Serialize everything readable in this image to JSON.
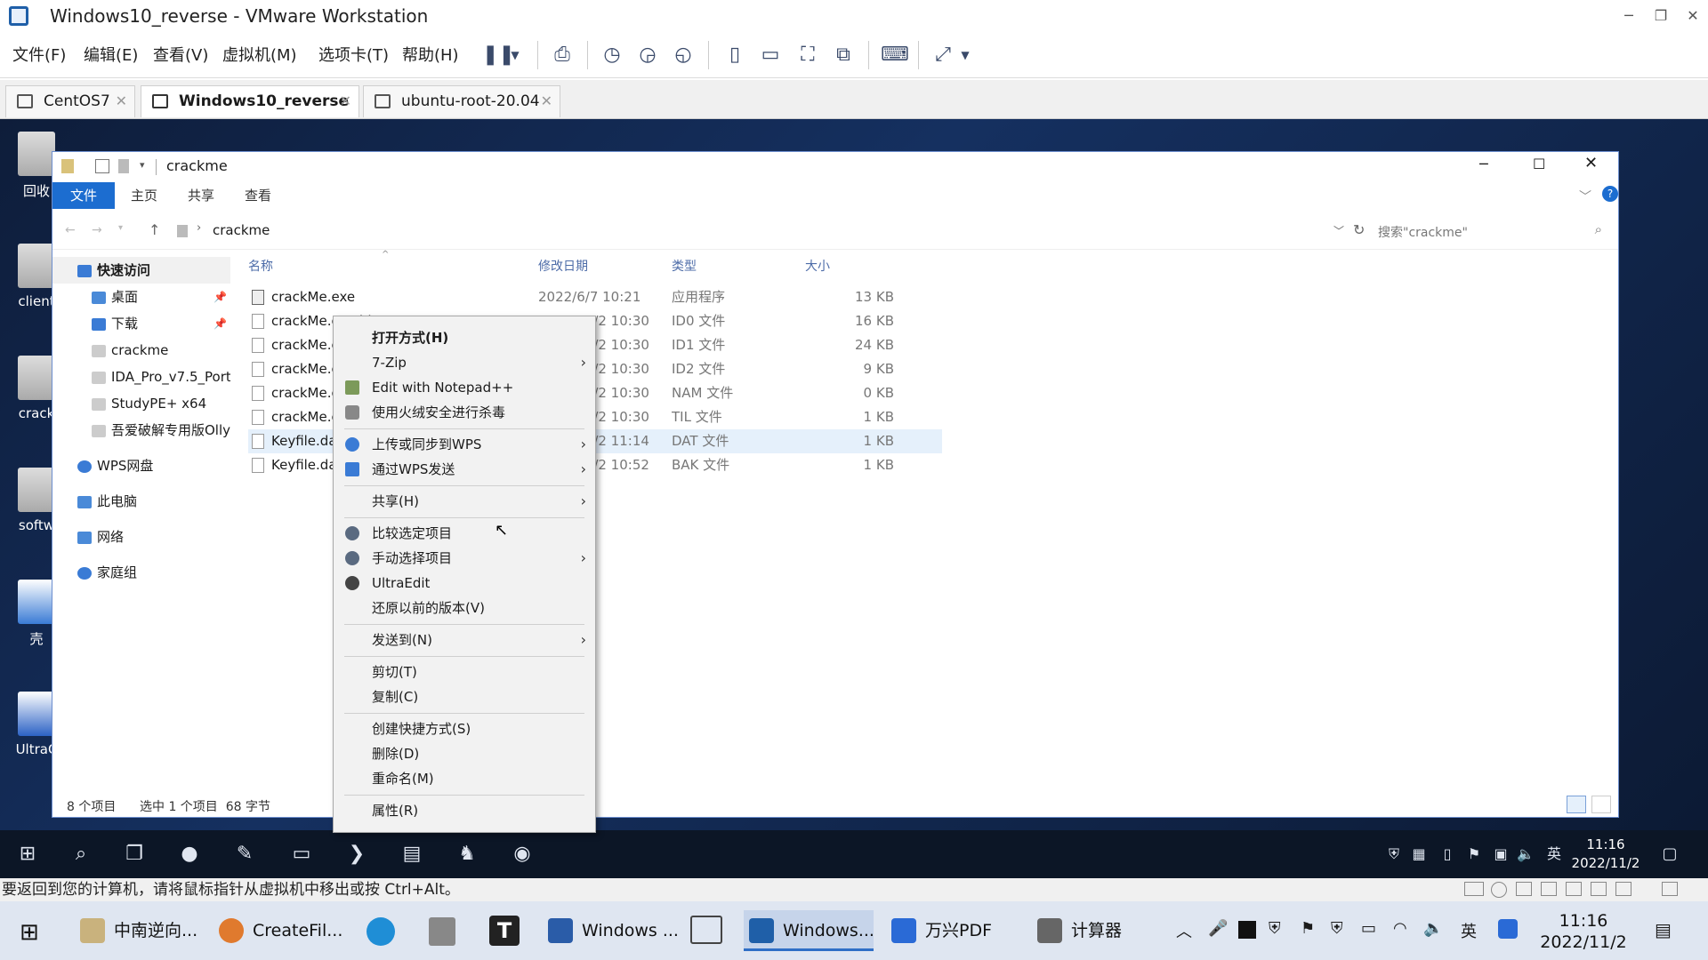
{
  "vmware": {
    "title": "Windows10_reverse - VMware Workstation",
    "menu": [
      "文件(F)",
      "编辑(E)",
      "查看(V)",
      "虚拟机(M)",
      "选项卡(T)",
      "帮助(H)"
    ],
    "tabs": [
      {
        "label": "CentOS7"
      },
      {
        "label": "Windows10_reverse"
      },
      {
        "label": "ubuntu-root-20.04"
      }
    ],
    "status_text": "要返回到您的计算机，请将鼠标指针从虚拟机中移出或按 Ctrl+Alt。"
  },
  "desktop": {
    "icons": [
      "回收",
      "client",
      "crack",
      "softw",
      "壳",
      "UltraC"
    ]
  },
  "explorer": {
    "title": "crackme",
    "ribbon_tabs": [
      "文件",
      "主页",
      "共享",
      "查看"
    ],
    "breadcrumb": "crackme",
    "search_placeholder": "搜索\"crackme\"",
    "nav": [
      {
        "label": "快速访问"
      },
      {
        "label": "桌面"
      },
      {
        "label": "下载"
      },
      {
        "label": "crackme"
      },
      {
        "label": "IDA_Pro_v7.5_Port"
      },
      {
        "label": "StudyPE+ x64"
      },
      {
        "label": "吾爱破解专用版Olly"
      },
      {
        "label": "WPS网盘"
      },
      {
        "label": "此电脑"
      },
      {
        "label": "网络"
      },
      {
        "label": "家庭组"
      }
    ],
    "columns": {
      "name": "名称",
      "date": "修改日期",
      "type": "类型",
      "size": "大小"
    },
    "files": [
      {
        "name": "crackMe.exe",
        "date": "2022/6/7 10:21",
        "type": "应用程序",
        "size": "13 KB"
      },
      {
        "name": "crackMe.exe.id0",
        "date": "2022/11/2 10:30",
        "type": "ID0 文件",
        "size": "16 KB"
      },
      {
        "name": "crackMe.exe.id1",
        "date": "2022/11/2 10:30",
        "type": "ID1 文件",
        "size": "24 KB"
      },
      {
        "name": "crackMe.exe.id2",
        "date": "2022/11/2 10:30",
        "type": "ID2 文件",
        "size": "9 KB"
      },
      {
        "name": "crackMe.exe.nam",
        "date": "2022/11/2 10:30",
        "type": "NAM 文件",
        "size": "0 KB"
      },
      {
        "name": "crackMe.exe.til",
        "date": "2022/11/2 10:30",
        "type": "TIL 文件",
        "size": "1 KB"
      },
      {
        "name": "Keyfile.dat",
        "date": "2022/11/2 11:14",
        "type": "DAT 文件",
        "size": "1 KB"
      },
      {
        "name": "Keyfile.dat.bak",
        "date": "2022/11/2 10:52",
        "type": "BAK 文件",
        "size": "1 KB"
      }
    ],
    "status": {
      "count": "8 个项目",
      "selected": "选中 1 个项目  68 字节"
    }
  },
  "context_menu": {
    "items": [
      {
        "label": "打开方式(H)"
      },
      {
        "label": "7-Zip"
      },
      {
        "label": "Edit with Notepad++"
      },
      {
        "label": "使用火绒安全进行杀毒"
      },
      {
        "label": "上传或同步到WPS"
      },
      {
        "label": "通过WPS发送"
      },
      {
        "label": "共享(H)"
      },
      {
        "label": "比较选定项目"
      },
      {
        "label": "手动选择项目"
      },
      {
        "label": "UltraEdit"
      },
      {
        "label": "还原以前的版本(V)"
      },
      {
        "label": "发送到(N)"
      },
      {
        "label": "剪切(T)"
      },
      {
        "label": "复制(C)"
      },
      {
        "label": "创建快捷方式(S)"
      },
      {
        "label": "删除(D)"
      },
      {
        "label": "重命名(M)"
      },
      {
        "label": "属性(R)"
      }
    ]
  },
  "guest_taskbar": {
    "ime": "英",
    "time": "11:16",
    "date": "2022/11/2"
  },
  "host_taskbar": {
    "items": [
      {
        "label": "中南逆向..."
      },
      {
        "label": "CreateFil..."
      },
      {
        "label": "Windows ..."
      },
      {
        "label": "Windows..."
      },
      {
        "label": "万兴PDF"
      },
      {
        "label": "计算器"
      }
    ],
    "ime": "英",
    "time": "11:16",
    "date": "2022/11/2"
  },
  "colors": {
    "accent": "#1c6dd0",
    "guest_bg": "#0e1d3a",
    "host_taskbar": "#dfe6f1"
  }
}
